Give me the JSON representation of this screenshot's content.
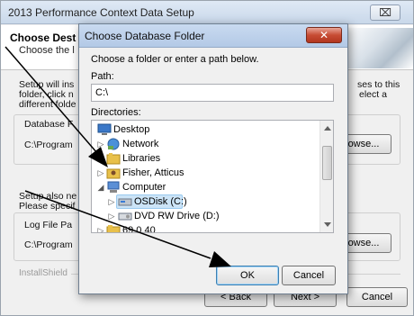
{
  "background_window": {
    "title": "2013 Performance Context Data Setup",
    "close_glyph": "⌧",
    "header_title": "Choose Dest",
    "header_subtitle": "Choose the l",
    "para1_lines": [
      "Setup will ins",
      "folder, click n",
      "different folde"
    ],
    "para1_right_lines": [
      "ses to this",
      "elect a"
    ],
    "database_label": "Database F",
    "database_path": "C:\\Program",
    "browse1_label": "owse...",
    "para2_lines": [
      "Setup also ne",
      "Please specif"
    ],
    "log_label": "Log File Pa",
    "log_path": "C:\\Program",
    "browse2_label": "owse...",
    "installshield_label": "InstallShield",
    "back_label": "< Back",
    "next_label": "Next >",
    "cancel_label": "Cancel"
  },
  "dialog": {
    "title": "Choose Database Folder",
    "close_glyph": "✕",
    "instruction": "Choose a folder or enter a path below.",
    "path_label": "Path:",
    "path_value": "C:\\",
    "directories_label": "Directories:",
    "tree": [
      {
        "label": "Desktop",
        "icon": "desktop-icon",
        "toggle": ""
      },
      {
        "label": "Network",
        "icon": "network-icon",
        "toggle": "▷"
      },
      {
        "label": "Libraries",
        "icon": "libraries-icon",
        "toggle": "▷"
      },
      {
        "label": "Fisher, Atticus",
        "icon": "user-folder-icon",
        "toggle": "▷"
      },
      {
        "label": "Computer",
        "icon": "computer-icon",
        "toggle": "◢"
      },
      {
        "label": "OSDisk (C:)",
        "icon": "hard-drive-icon",
        "toggle": "▷",
        "selected": true
      },
      {
        "label": "DVD RW Drive (D:)",
        "icon": "dvd-drive-icon",
        "toggle": "▷"
      },
      {
        "label": "69.0.40",
        "icon": "folder-icon",
        "toggle": "▷"
      }
    ],
    "ok_label": "OK",
    "cancel_label": "Cancel"
  },
  "colors": {
    "selection": "#cce4f7",
    "close_button": "#c74c34",
    "folder": "#e8c04a"
  }
}
